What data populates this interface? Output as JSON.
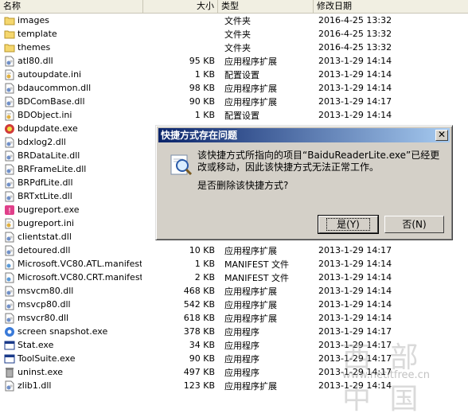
{
  "columns": {
    "name": "名称",
    "size": "大小",
    "type": "类型",
    "modified": "修改日期"
  },
  "files": [
    {
      "name": "images",
      "size": "",
      "type": "文件夹",
      "date": "2016-4-25 13:32",
      "icon": "folder-icon"
    },
    {
      "name": "template",
      "size": "",
      "type": "文件夹",
      "date": "2016-4-25 13:32",
      "icon": "folder-icon"
    },
    {
      "name": "themes",
      "size": "",
      "type": "文件夹",
      "date": "2016-4-25 13:32",
      "icon": "folder-icon"
    },
    {
      "name": "atl80.dll",
      "size": "95 KB",
      "type": "应用程序扩展",
      "date": "2013-1-29 14:14",
      "icon": "dll-icon"
    },
    {
      "name": "autoupdate.ini",
      "size": "1 KB",
      "type": "配置设置",
      "date": "2013-1-29 14:14",
      "icon": "ini-icon"
    },
    {
      "name": "bdaucommon.dll",
      "size": "98 KB",
      "type": "应用程序扩展",
      "date": "2013-1-29 14:14",
      "icon": "dll-icon"
    },
    {
      "name": "BDComBase.dll",
      "size": "90 KB",
      "type": "应用程序扩展",
      "date": "2013-1-29 14:17",
      "icon": "dll-icon"
    },
    {
      "name": "BDObject.ini",
      "size": "1 KB",
      "type": "配置设置",
      "date": "2013-1-29 14:14",
      "icon": "ini-icon"
    },
    {
      "name": "bdupdate.exe",
      "size": "",
      "type": "",
      "date": "",
      "icon": "update-exe-icon"
    },
    {
      "name": "bdxlog2.dll",
      "size": "",
      "type": "",
      "date": "",
      "icon": "dll-icon"
    },
    {
      "name": "BRDataLite.dll",
      "size": "",
      "type": "",
      "date": "",
      "icon": "dll-icon"
    },
    {
      "name": "BRFrameLite.dll",
      "size": "",
      "type": "",
      "date": "",
      "icon": "dll-icon"
    },
    {
      "name": "BRPdfLite.dll",
      "size": "",
      "type": "",
      "date": "",
      "icon": "dll-icon"
    },
    {
      "name": "BRTxtLite.dll",
      "size": "",
      "type": "",
      "date": "",
      "icon": "dll-icon"
    },
    {
      "name": "bugreport.exe",
      "size": "",
      "type": "",
      "date": "",
      "icon": "bugreport-exe-icon"
    },
    {
      "name": "bugreport.ini",
      "size": "",
      "type": "",
      "date": "",
      "icon": "ini-icon"
    },
    {
      "name": "clientstat.dll",
      "size": "",
      "type": "",
      "date": "",
      "icon": "dll-icon"
    },
    {
      "name": "detoured.dll",
      "size": "10 KB",
      "type": "应用程序扩展",
      "date": "2013-1-29 14:17",
      "icon": "dll-icon"
    },
    {
      "name": "Microsoft.VC80.ATL.manifest",
      "size": "1 KB",
      "type": "MANIFEST 文件",
      "date": "2013-1-29 14:14",
      "icon": "manifest-icon"
    },
    {
      "name": "Microsoft.VC80.CRT.manifest",
      "size": "2 KB",
      "type": "MANIFEST 文件",
      "date": "2013-1-29 14:14",
      "icon": "manifest-icon"
    },
    {
      "name": "msvcm80.dll",
      "size": "468 KB",
      "type": "应用程序扩展",
      "date": "2013-1-29 14:14",
      "icon": "dll-icon"
    },
    {
      "name": "msvcp80.dll",
      "size": "542 KB",
      "type": "应用程序扩展",
      "date": "2013-1-29 14:14",
      "icon": "dll-icon"
    },
    {
      "name": "msvcr80.dll",
      "size": "618 KB",
      "type": "应用程序扩展",
      "date": "2013-1-29 14:14",
      "icon": "dll-icon"
    },
    {
      "name": "screen snapshot.exe",
      "size": "378 KB",
      "type": "应用程序",
      "date": "2013-1-29 14:17",
      "icon": "snapshot-exe-icon"
    },
    {
      "name": "Stat.exe",
      "size": "34 KB",
      "type": "应用程序",
      "date": "2013-1-29 14:17",
      "icon": "window-exe-icon"
    },
    {
      "name": "ToolSuite.exe",
      "size": "90 KB",
      "type": "应用程序",
      "date": "2013-1-29 14:17",
      "icon": "window-exe-icon"
    },
    {
      "name": "uninst.exe",
      "size": "497 KB",
      "type": "应用程序",
      "date": "2013-1-29 14:17",
      "icon": "uninstall-exe-icon"
    },
    {
      "name": "zlib1.dll",
      "size": "123 KB",
      "type": "应用程序扩展",
      "date": "2013-1-29 14:14",
      "icon": "dll-icon"
    }
  ],
  "dialog": {
    "title": "快捷方式存在问题",
    "close_label": "✕",
    "message": "该快捷方式所指向的项目“BaiduReaderLite.exe”已经更改或移动，因此该快捷方式无法正常工作。",
    "question": "是否删除该快捷方式?",
    "yes_label": "是(Y)",
    "no_label": "否(N)",
    "icon": "shortcut-search-icon"
  },
  "watermark": {
    "big": "西 部 中 国",
    "small": "www.netitfree.cn"
  }
}
